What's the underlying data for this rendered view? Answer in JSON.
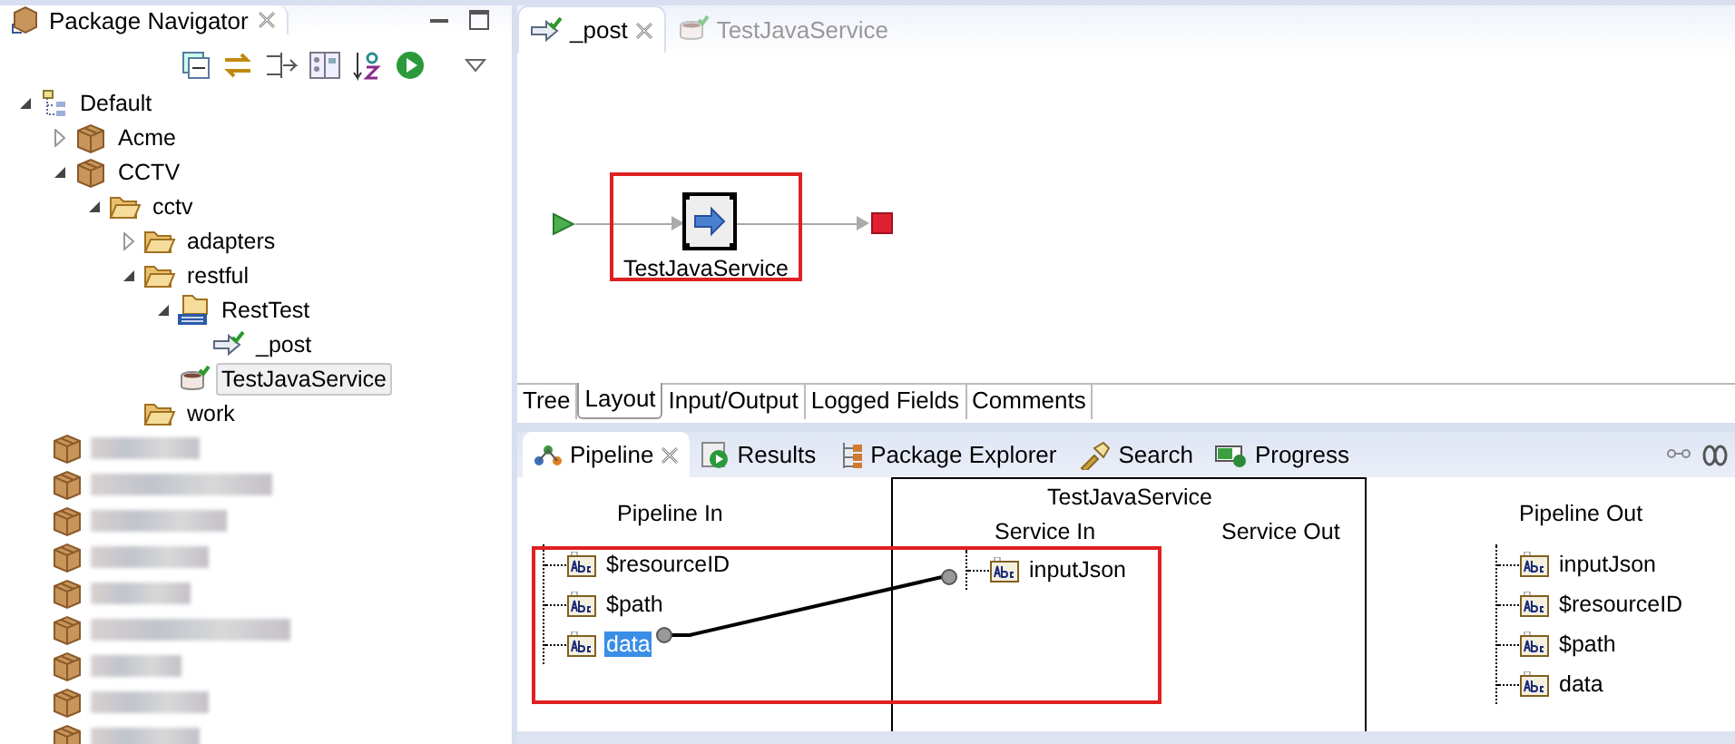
{
  "navigator": {
    "title": "Package Navigator",
    "tree": [
      {
        "label": "Default",
        "kind": "group",
        "expanded": true,
        "selected": false,
        "children": [
          {
            "label": "Acme",
            "kind": "package",
            "expanded": false,
            "selected": false
          },
          {
            "label": "CCTV",
            "kind": "package",
            "expanded": true,
            "selected": false,
            "children": [
              {
                "label": "cctv",
                "kind": "folder",
                "expanded": true,
                "selected": false,
                "children": [
                  {
                    "label": "adapters",
                    "kind": "folder",
                    "expanded": false,
                    "selected": false
                  },
                  {
                    "label": "restful",
                    "kind": "folder",
                    "expanded": true,
                    "selected": false,
                    "children": [
                      {
                        "label": "RestTest",
                        "kind": "rest",
                        "expanded": true,
                        "selected": false,
                        "children": [
                          {
                            "label": "_post",
                            "kind": "flow",
                            "selected": false
                          }
                        ]
                      },
                      {
                        "label": "TestJavaService",
                        "kind": "java",
                        "selected": true
                      }
                    ]
                  },
                  {
                    "label": "work",
                    "kind": "folder",
                    "selected": false
                  }
                ]
              }
            ]
          }
        ]
      }
    ],
    "hidden_rows": [
      {
        "kind": "blurred"
      },
      {
        "kind": "blurred"
      },
      {
        "kind": "blurred"
      },
      {
        "kind": "blurred"
      },
      {
        "kind": "blurred"
      },
      {
        "kind": "blurred"
      },
      {
        "kind": "blurred"
      },
      {
        "kind": "blurred"
      },
      {
        "kind": "blurred"
      }
    ]
  },
  "editor": {
    "tabs": [
      {
        "label": "_post",
        "kind": "flow",
        "selected": true
      },
      {
        "label": "TestJavaService",
        "kind": "java",
        "selected": false
      }
    ],
    "flow": {
      "step": "TestJavaService",
      "callouts": [
        {
          "kind": "frame"
        }
      ]
    },
    "bottom_tabs": [
      {
        "label": "Tree",
        "selected": false
      },
      {
        "label": "Layout",
        "selected": true
      },
      {
        "label": "Input/Output",
        "selected": false
      },
      {
        "label": "Logged Fields",
        "selected": false
      },
      {
        "label": "Comments",
        "selected": false
      }
    ]
  },
  "pipeline": {
    "tabs": [
      {
        "label": "Pipeline",
        "kind": "pipeline",
        "selected": true
      },
      {
        "label": "Results",
        "kind": "results",
        "selected": false
      },
      {
        "label": "Package Explorer",
        "kind": "explorer",
        "selected": false
      },
      {
        "label": "Search",
        "kind": "search",
        "selected": false
      },
      {
        "label": "Progress",
        "kind": "progress",
        "selected": false
      }
    ],
    "pipeline_in": {
      "title": "Pipeline In",
      "fields": [
        {
          "name": "$resourceID",
          "selected": false
        },
        {
          "name": "$path",
          "selected": false
        },
        {
          "name": "data",
          "selected": true
        }
      ]
    },
    "service": {
      "title": "TestJavaService",
      "service_in": {
        "title": "Service In",
        "fields": [
          {
            "name": "inputJson",
            "selected": false
          }
        ]
      },
      "service_out": {
        "title": "Service Out"
      }
    },
    "pipeline_out": {
      "title": "Pipeline Out",
      "fields": [
        {
          "name": "inputJson",
          "selected": false
        },
        {
          "name": "$resourceID",
          "selected": false
        },
        {
          "name": "$path",
          "selected": false
        },
        {
          "name": "data",
          "selected": false
        }
      ]
    },
    "callouts": [
      {
        "kind": "frame"
      }
    ]
  }
}
